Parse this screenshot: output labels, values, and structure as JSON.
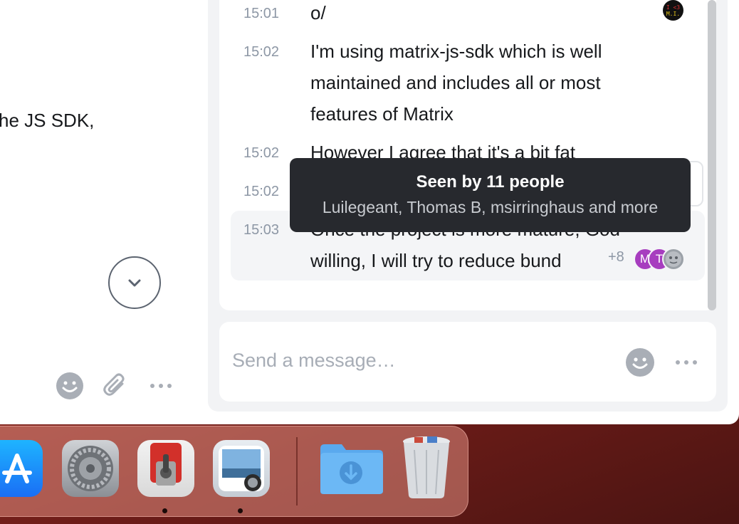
{
  "left_pane": {
    "snippet_text": "he JS SDK,",
    "scroll_down_label": "Jump to latest",
    "icons": [
      "emoji-icon",
      "paperclip-icon",
      "more-icon"
    ]
  },
  "timeline": {
    "messages": [
      {
        "time": "15:01",
        "text": "o/"
      },
      {
        "time": "15:02",
        "lines": [
          "I'm using matrix-js-sdk which is well",
          "maintained and includes all or most",
          "features of Matrix"
        ]
      },
      {
        "time": "15:02",
        "text": "However I agree that it's a bit fat"
      },
      {
        "time": "15:02",
        "text": ""
      },
      {
        "time": "15:03",
        "lines": [
          "Once the project is more mature, God",
          "willing, I will try to reduce bund"
        ]
      }
    ],
    "avatar_top_text": [
      "I <3",
      "M.I."
    ]
  },
  "tooltip": {
    "title": "Seen by 11 people",
    "subtitle": "Luilegeant, Thomas B, msirringhaus and more"
  },
  "read_receipts": {
    "count_label": "+8",
    "avatars": [
      {
        "initial": "M",
        "color": "#a73dbf"
      },
      {
        "initial": "T",
        "color": "#a73dbf"
      },
      {
        "initial": "",
        "color": "#9ba1a8"
      }
    ]
  },
  "composer": {
    "placeholder": "Send a message…"
  },
  "dock": {
    "items": [
      "App Store",
      "System Settings",
      "Jolt",
      "Preview",
      "Downloads",
      "Trash"
    ]
  },
  "colors": {
    "accent": "#a73dbf",
    "tooltip_bg": "#27292e",
    "muted": "#8d97a5"
  }
}
